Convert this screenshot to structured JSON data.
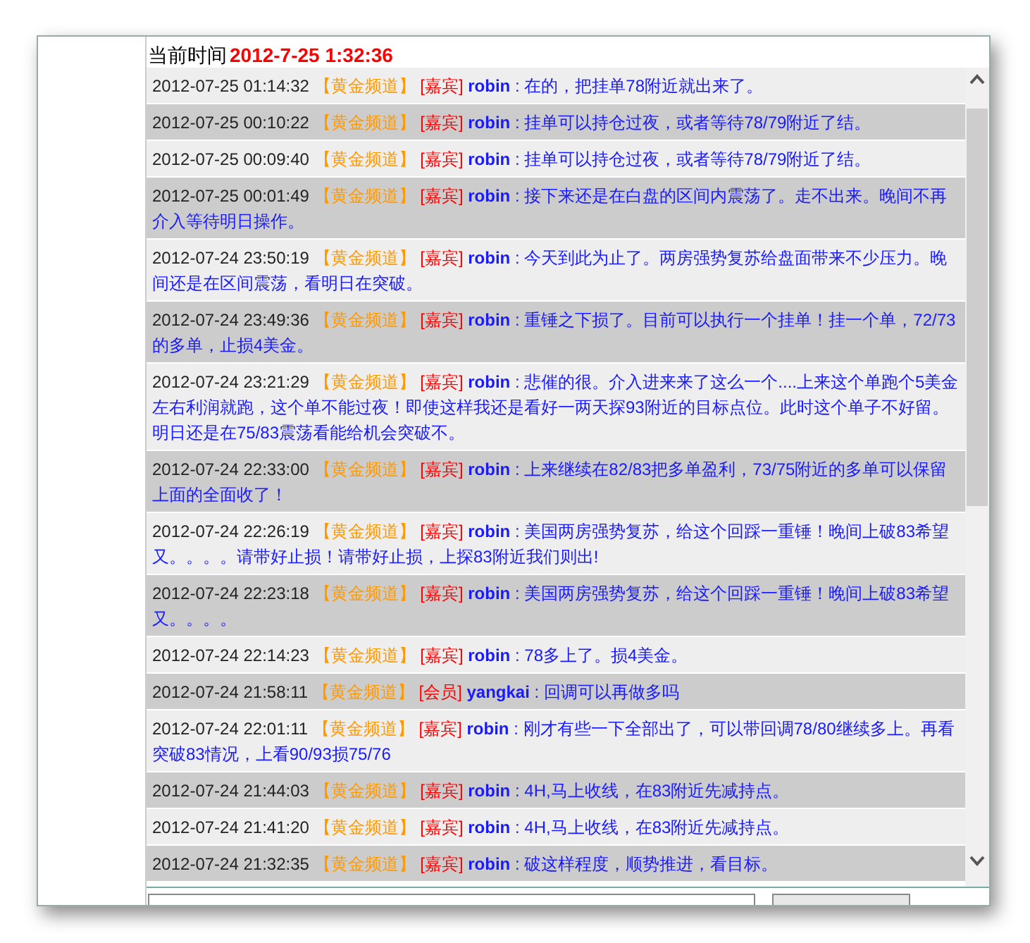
{
  "header": {
    "label": "当前时间",
    "time": "2012-7-25 1:32:36"
  },
  "messages": [
    {
      "time": "2012-07-25 01:14:32",
      "channel": "【黄金频道】",
      "role": "[嘉宾]",
      "user": "robin",
      "text": ": 在的，把挂单78附近就出来了。"
    },
    {
      "time": "2012-07-25 00:10:22",
      "channel": "【黄金频道】",
      "role": "[嘉宾]",
      "user": "robin",
      "text": ": 挂单可以持仓过夜，或者等待78/79附近了结。"
    },
    {
      "time": "2012-07-25 00:09:40",
      "channel": "【黄金频道】",
      "role": "[嘉宾]",
      "user": "robin",
      "text": ": 挂单可以持仓过夜，或者等待78/79附近了结。"
    },
    {
      "time": "2012-07-25 00:01:49",
      "channel": "【黄金频道】",
      "role": "[嘉宾]",
      "user": "robin",
      "text": ": 接下来还是在白盘的区间内震荡了。走不出来。晚间不再介入等待明日操作。"
    },
    {
      "time": "2012-07-24 23:50:19",
      "channel": "【黄金频道】",
      "role": "[嘉宾]",
      "user": "robin",
      "text": ": 今天到此为止了。两房强势复苏给盘面带来不少压力。晚间还是在区间震荡，看明日在突破。"
    },
    {
      "time": "2012-07-24 23:49:36",
      "channel": "【黄金频道】",
      "role": "[嘉宾]",
      "user": "robin",
      "text": ": 重锤之下损了。目前可以执行一个挂单！挂一个单，72/73的多单，止损4美金。"
    },
    {
      "time": "2012-07-24 23:21:29",
      "channel": "【黄金频道】",
      "role": "[嘉宾]",
      "user": "robin",
      "text": ": 悲催的很。介入进来来了这么一个....上来这个单跑个5美金左右利润就跑，这个单不能过夜！即使这样我还是看好一两天探93附近的目标点位。此时这个单子不好留。明日还是在75/83震荡看能给机会突破不。"
    },
    {
      "time": "2012-07-24 22:33:00",
      "channel": "【黄金频道】",
      "role": "[嘉宾]",
      "user": "robin",
      "text": ": 上来继续在82/83把多单盈利，73/75附近的多单可以保留上面的全面收了！"
    },
    {
      "time": "2012-07-24 22:26:19",
      "channel": "【黄金频道】",
      "role": "[嘉宾]",
      "user": "robin",
      "text": ": 美国两房强势复苏，给这个回踩一重锤！晚间上破83希望又。。。。请带好止损！请带好止损，上探83附近我们则出!"
    },
    {
      "time": "2012-07-24 22:23:18",
      "channel": "【黄金频道】",
      "role": "[嘉宾]",
      "user": "robin",
      "text": ": 美国两房强势复苏，给这个回踩一重锤！晚间上破83希望又。。。。"
    },
    {
      "time": "2012-07-24 22:14:23",
      "channel": "【黄金频道】",
      "role": "[嘉宾]",
      "user": "robin",
      "text": ": 78多上了。损4美金。"
    },
    {
      "time": "2012-07-24 21:58:11",
      "channel": "【黄金频道】",
      "role": "[会员]",
      "user": "yangkai",
      "text": ": 回调可以再做多吗"
    },
    {
      "time": "2012-07-24 22:01:11",
      "channel": "【黄金频道】",
      "role": "[嘉宾]",
      "user": "robin",
      "text": ": 刚才有些一下全部出了，可以带回调78/80继续多上。再看突破83情况，上看90/93损75/76"
    },
    {
      "time": "2012-07-24 21:44:03",
      "channel": "【黄金频道】",
      "role": "[嘉宾]",
      "user": "robin",
      "text": ": 4H,马上收线，在83附近先减持点。"
    },
    {
      "time": "2012-07-24 21:41:20",
      "channel": "【黄金频道】",
      "role": "[嘉宾]",
      "user": "robin",
      "text": ": 4H,马上收线，在83附近先减持点。"
    },
    {
      "time": "2012-07-24 21:32:35",
      "channel": "【黄金频道】",
      "role": "[嘉宾]",
      "user": "robin",
      "text": ": 破这样程度，顺势推进，看目标。"
    }
  ]
}
